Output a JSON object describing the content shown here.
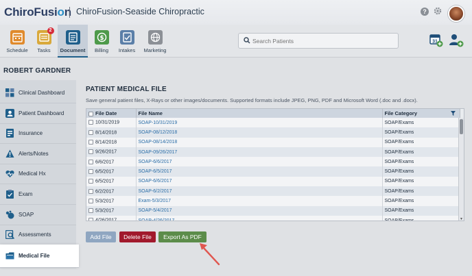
{
  "header": {
    "logo_part1": "ChiroFusi",
    "logo_o": "o",
    "logo_part2": "n",
    "practice_name": "ChiroFusion-Seaside Chiropractic",
    "help_glyph": "?"
  },
  "nav": {
    "items": [
      {
        "label": "Schedule",
        "icon": "calendar-icon",
        "color": "#e08a2c"
      },
      {
        "label": "Tasks",
        "icon": "tasks-icon",
        "color": "#d9a93b",
        "badge": "2"
      },
      {
        "label": "Document",
        "icon": "document-icon",
        "color": "#1f5f8b",
        "active": true
      },
      {
        "label": "Billing",
        "icon": "billing-icon",
        "color": "#4e9a4a"
      },
      {
        "label": "Intakes",
        "icon": "intakes-icon",
        "color": "#5b7fa8"
      },
      {
        "label": "Marketing",
        "icon": "marketing-icon",
        "color": "#8c9096"
      }
    ],
    "search_placeholder": "Search Patients",
    "calendar_day": "31"
  },
  "patient": {
    "name": "ROBERT GARDNER"
  },
  "sidebar": {
    "items": [
      {
        "label": "Clinical Dashboard",
        "icon": "clinical-dashboard-icon"
      },
      {
        "label": "Patient Dashboard",
        "icon": "patient-dashboard-icon"
      },
      {
        "label": "Insurance",
        "icon": "insurance-icon"
      },
      {
        "label": "Alerts/Notes",
        "icon": "alert-icon"
      },
      {
        "label": "Medical Hx",
        "icon": "medical-hx-icon"
      },
      {
        "label": "Exam",
        "icon": "exam-icon"
      },
      {
        "label": "SOAP",
        "icon": "soap-icon"
      },
      {
        "label": "Assessments",
        "icon": "assessments-icon"
      },
      {
        "label": "Medical File",
        "icon": "medical-file-icon",
        "active": true
      }
    ]
  },
  "main": {
    "title": "PATIENT MEDICAL FILE",
    "subtitle": "Save general patient files, X-Rays or other images/documents. Supported formats include JPEG, PNG, PDF and Microsoft Word (.doc and .docx).",
    "columns": [
      "File Date",
      "File Name",
      "File Category"
    ],
    "rows": [
      [
        "10/31/2019",
        "SOAP-10/31/2019",
        "SOAP/Exams"
      ],
      [
        "8/14/2018",
        "SOAP-08/12/2018",
        "SOAP/Exams"
      ],
      [
        "8/14/2018",
        "SOAP-08/14/2018",
        "SOAP/Exams"
      ],
      [
        "9/26/2017",
        "SOAP-09/26/2017",
        "SOAP/Exams"
      ],
      [
        "6/6/2017",
        "SOAP-6/6/2017",
        "SOAP/Exams"
      ],
      [
        "6/5/2017",
        "SOAP-6/5/2017",
        "SOAP/Exams"
      ],
      [
        "6/5/2017",
        "SOAP-6/6/2017",
        "SOAP/Exams"
      ],
      [
        "6/2/2017",
        "SOAP-6/2/2017",
        "SOAP/Exams"
      ],
      [
        "5/3/2017",
        "Exam-5/3/2017",
        "SOAP/Exams"
      ],
      [
        "5/3/2017",
        "SOAP-5/4/2017",
        "SOAP/Exams"
      ],
      [
        "4/26/2017",
        "SOAP-4/26/2017",
        "SOAP/Exams"
      ]
    ],
    "buttons": {
      "add": "Add File",
      "delete": "Delete File",
      "export": "Export As PDF"
    }
  },
  "colors": {
    "accent": "#1f5f8b",
    "delete": "#a1192c",
    "export": "#5c8c4a",
    "add": "#8fa6c1",
    "arrow": "#e0564f"
  }
}
